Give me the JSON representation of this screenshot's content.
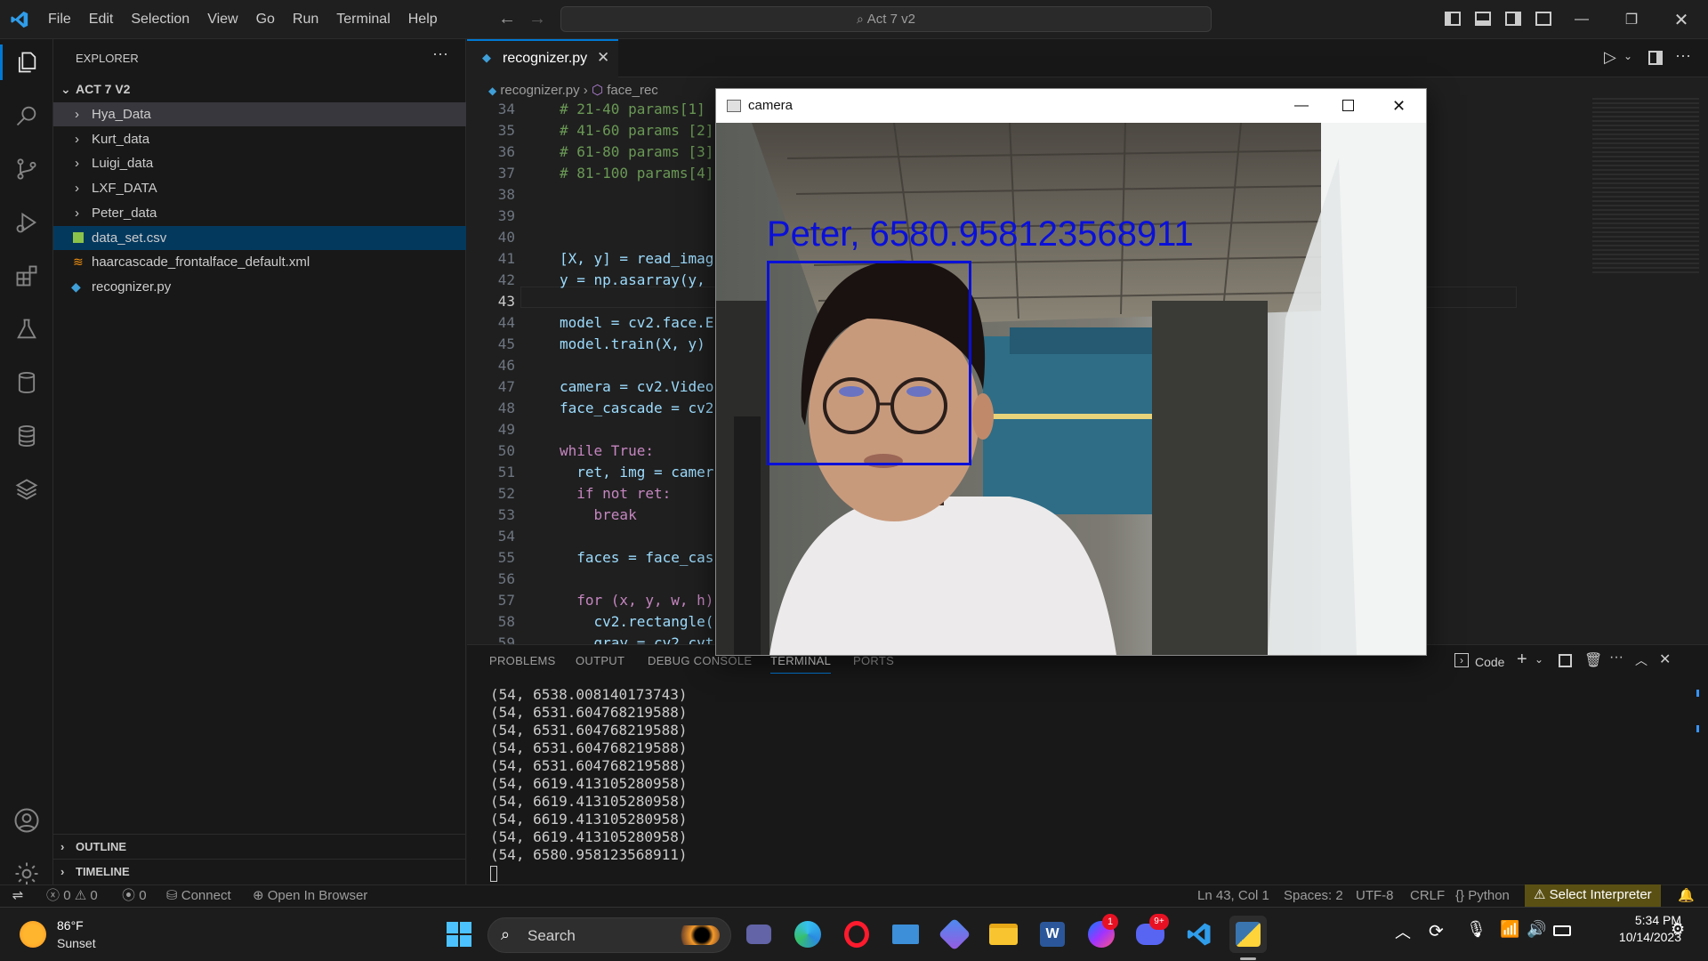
{
  "titlebar": {
    "menu": [
      "File",
      "Edit",
      "Selection",
      "View",
      "Go",
      "Run",
      "Terminal",
      "Help"
    ],
    "search": "Act 7 v2"
  },
  "sidebar": {
    "header": "EXPLORER",
    "project": "ACT 7 V2",
    "folders": [
      "Hya_Data",
      "Kurt_data",
      "Luigi_data",
      "LXF_DATA",
      "Peter_data"
    ],
    "files": [
      "data_set.csv",
      "haarcascade_frontalface_default.xml",
      "recognizer.py"
    ],
    "outline": "OUTLINE",
    "timeline": "TIMELINE"
  },
  "editor": {
    "tab": "recognizer.py",
    "breadcrumb_file": "recognizer.py",
    "breadcrumb_symbol": "face_rec",
    "lines": [
      {
        "n": "34",
        "t": "# 21-40 params[1]"
      },
      {
        "n": "35",
        "t": "# 41-60 params [2]"
      },
      {
        "n": "36",
        "t": "# 61-80 params [3]"
      },
      {
        "n": "37",
        "t": "# 81-100 params[4]"
      },
      {
        "n": "38",
        "t": ""
      },
      {
        "n": "39",
        "t": ""
      },
      {
        "n": "40",
        "t": ""
      },
      {
        "n": "41",
        "t": "[X, y] = read_imag"
      },
      {
        "n": "42",
        "t": "y = np.asarray(y,"
      },
      {
        "n": "43",
        "t": ""
      },
      {
        "n": "44",
        "t": "model = cv2.face.E"
      },
      {
        "n": "45",
        "t": "model.train(X, y)"
      },
      {
        "n": "46",
        "t": ""
      },
      {
        "n": "47",
        "t": "camera = cv2.Video"
      },
      {
        "n": "48",
        "t": "face_cascade = cv2"
      },
      {
        "n": "49",
        "t": ""
      },
      {
        "n": "50",
        "t": "while True:"
      },
      {
        "n": "51",
        "t": "  ret, img = camer"
      },
      {
        "n": "52",
        "t": "  if not ret:"
      },
      {
        "n": "53",
        "t": "    break"
      },
      {
        "n": "54",
        "t": ""
      },
      {
        "n": "55",
        "t": "  faces = face_cas"
      },
      {
        "n": "56",
        "t": ""
      },
      {
        "n": "57",
        "t": "  for (x, y, w, h)"
      },
      {
        "n": "58",
        "t": "    cv2.rectangle("
      },
      {
        "n": "59",
        "t": "    gray = cv2.cvt"
      }
    ]
  },
  "panel": {
    "tabs": [
      "PROBLEMS",
      "OUTPUT",
      "DEBUG CONSOLE",
      "TERMINAL",
      "PORTS"
    ],
    "shell_label": "Code",
    "terminal": [
      "(54, 6538.008140173743)",
      "(54, 6531.604768219588)",
      "(54, 6531.604768219588)",
      "(54, 6531.604768219588)",
      "(54, 6531.604768219588)",
      "(54, 6619.413105280958)",
      "(54, 6619.413105280958)",
      "(54, 6619.413105280958)",
      "(54, 6619.413105280958)",
      "(54, 6580.958123568911)"
    ]
  },
  "camera": {
    "title": "camera",
    "label": "Peter, 6580.958123568911",
    "box_color": "#0a10d8"
  },
  "statusbar": {
    "errors": "0",
    "warnings": "0",
    "ports": "0",
    "connect": "Connect",
    "open_browser": "Open In Browser",
    "position": "Ln 43, Col 1",
    "spaces": "Spaces: 2",
    "encoding": "UTF-8",
    "eol": "CRLF",
    "language": "Python",
    "interpreter": "Select Interpreter"
  },
  "taskbar": {
    "weather_temp": "86°F",
    "weather_desc": "Sunset",
    "search": "Search",
    "time": "5:34 PM",
    "date": "10/14/2023",
    "messenger_badge": "1",
    "discord_badge": "9+"
  }
}
